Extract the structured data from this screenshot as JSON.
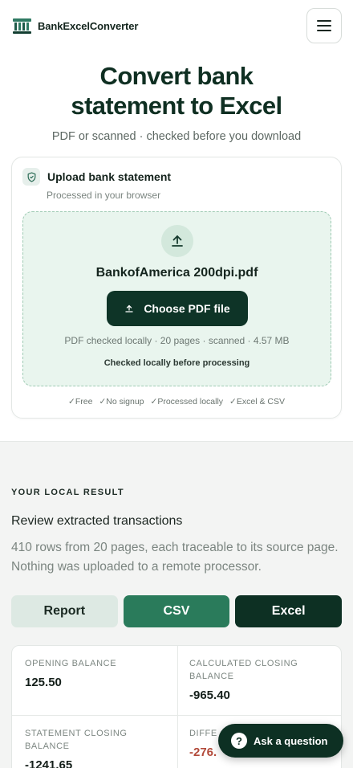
{
  "brand": {
    "name": "BankExcelConverter"
  },
  "hero": {
    "title_line1": "Convert bank",
    "title_line2": "statement to Excel",
    "subtitle": "PDF or scanned · checked before you download"
  },
  "upload": {
    "title": "Upload bank statement",
    "subtitle": "Processed in your browser",
    "file_name": "BankofAmerica 200dpi.pdf",
    "choose_label": "Choose PDF file",
    "file_meta": "PDF checked locally · 20 pages · scanned · 4.57 MB",
    "checked_note": "Checked locally before processing",
    "features": [
      "✓Free",
      "✓No signup",
      "✓Processed locally",
      "✓Excel & CSV"
    ]
  },
  "result": {
    "eyebrow": "YOUR LOCAL RESULT",
    "title": "Review extracted transactions",
    "description": "410 rows from 20 pages, each traceable to its source page. Nothing was uploaded to a remote processor.",
    "tabs": {
      "report": "Report",
      "csv": "CSV",
      "excel": "Excel"
    },
    "balances": {
      "opening_label": "OPENING BALANCE",
      "opening_value": "125.50",
      "calc_label": "CALCULATED CLOSING BALANCE",
      "calc_value": "-965.40",
      "statement_label": "STATEMENT CLOSING BALANCE",
      "statement_value": "-1241.65",
      "diff_label": "DIFFE",
      "diff_value": "-276."
    }
  },
  "ask": {
    "label": "Ask a question",
    "glyph": "?"
  },
  "colors": {
    "accent_dark": "#0e3427",
    "accent_green": "#2a7b5b",
    "dropzone_bg": "#e9f5ee"
  }
}
